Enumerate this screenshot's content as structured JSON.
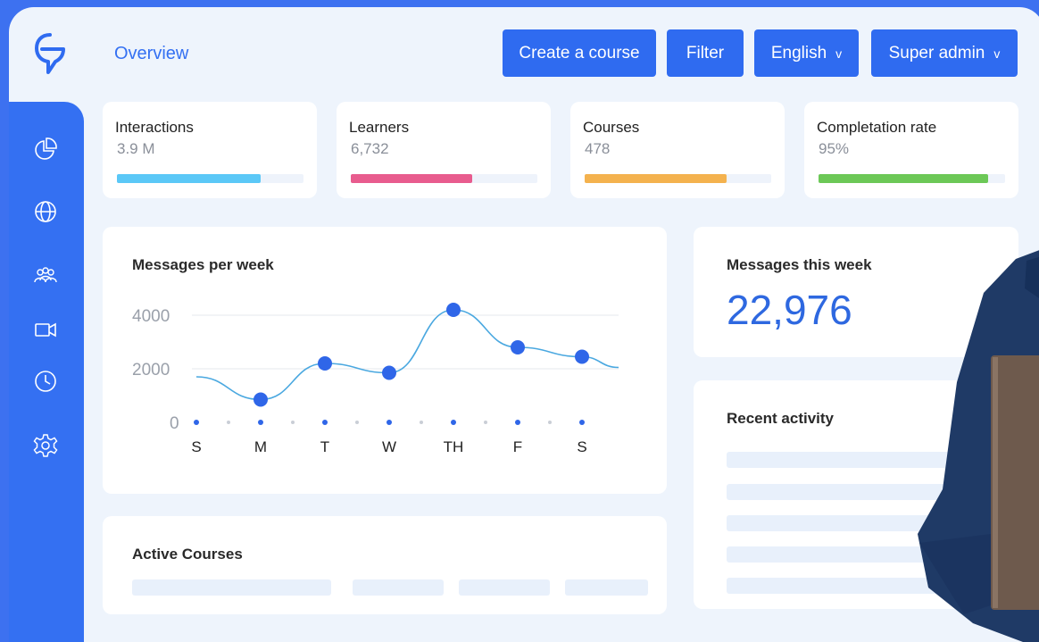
{
  "header": {
    "title": "Overview"
  },
  "toolbar": {
    "create_label": "Create a course",
    "filter_label": "Filter",
    "language": "English",
    "user": "Super admin",
    "chevron": "v"
  },
  "sidebar": {
    "items": [
      {
        "icon": "pie-chart-icon"
      },
      {
        "icon": "globe-icon"
      },
      {
        "icon": "users-icon"
      },
      {
        "icon": "video-camera-icon"
      },
      {
        "icon": "clock-icon"
      },
      {
        "icon": "gear-icon"
      }
    ]
  },
  "stats": [
    {
      "label": "Interactions",
      "value": "3.9 M",
      "progress": 0.77,
      "color": "#5bc8f7"
    },
    {
      "label": "Learners",
      "value": "6,732",
      "progress": 0.65,
      "color": "#e85c8e"
    },
    {
      "label": "Courses",
      "value": "478",
      "progress": 0.76,
      "color": "#f4b24e"
    },
    {
      "label": "Completation rate",
      "value": "95%",
      "progress": 0.91,
      "color": "#6cc857"
    }
  ],
  "messages_card": {
    "title": "Messages per week"
  },
  "chart_data": {
    "type": "line",
    "title": "Messages per week",
    "categories": [
      "S",
      "M",
      "T",
      "W",
      "TH",
      "F",
      "S"
    ],
    "series": [
      {
        "values": [
          1700,
          850,
          2200,
          1850,
          4200,
          2800,
          2450
        ]
      }
    ],
    "yticks": [
      0,
      2000,
      4000
    ],
    "ylim": [
      0,
      4500
    ],
    "grid": true,
    "line_color": "#4aa8e0",
    "marker_color": "#2f66e8"
  },
  "weekly_card": {
    "title": "Messages this week",
    "value": "22,976"
  },
  "recent_card": {
    "title": "Recent activity"
  },
  "courses_card": {
    "title": "Active Courses"
  }
}
